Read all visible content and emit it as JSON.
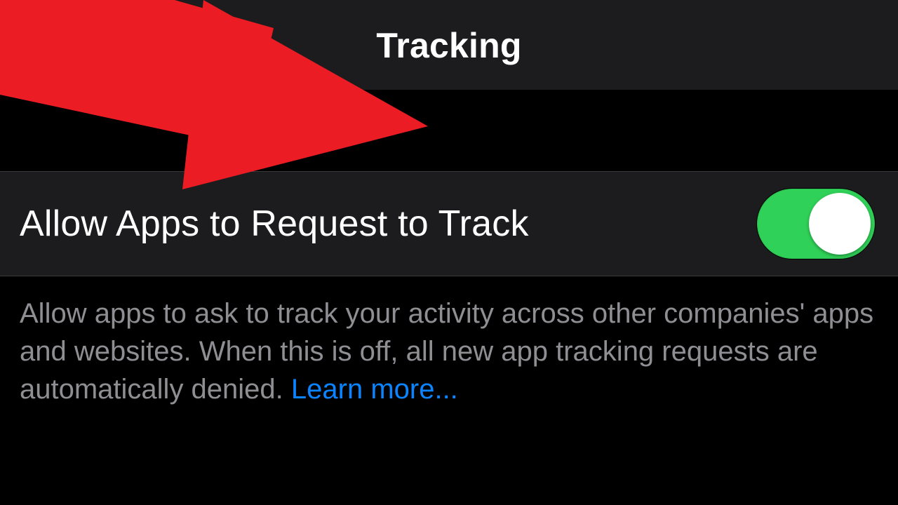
{
  "header": {
    "title": "Tracking"
  },
  "setting": {
    "label": "Allow Apps to Request to Track",
    "toggle_on": true
  },
  "footer": {
    "text": "Allow apps to ask to track your activity across other companies' apps and websites. When this is off, all new app tracking requests are automatically denied. ",
    "link": "Learn more..."
  },
  "colors": {
    "toggle_on": "#30d158",
    "link": "#0a84ff",
    "annotation_arrow": "#eb1c24"
  }
}
